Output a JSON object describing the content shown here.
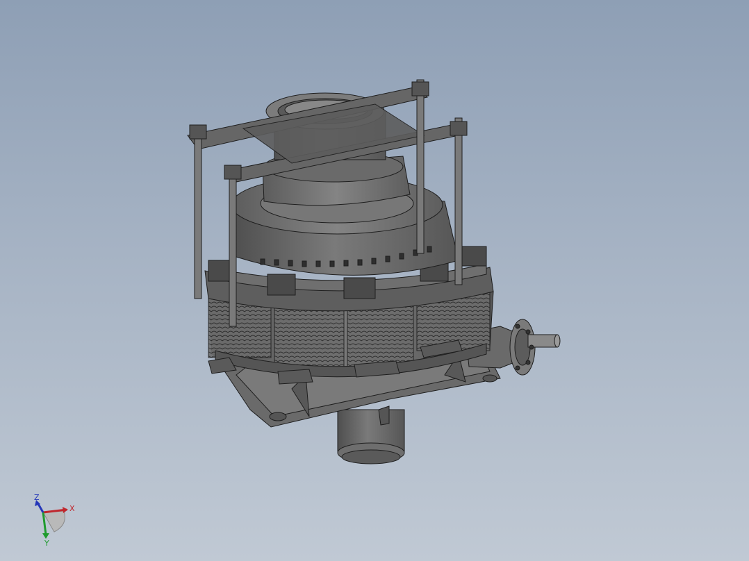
{
  "viewport": {
    "background_top": "#8e9fb5",
    "background_bottom": "#c0c9d4",
    "model_color": "#6b6b6b",
    "edge_color": "#1e1e1e"
  },
  "model": {
    "name": "cone-crusher-assembly"
  },
  "triad": {
    "x_label": "X",
    "y_label": "Y",
    "z_label": "Z",
    "x_color": "#c0272d",
    "y_color": "#1f9b2e",
    "z_color": "#2436b8"
  }
}
